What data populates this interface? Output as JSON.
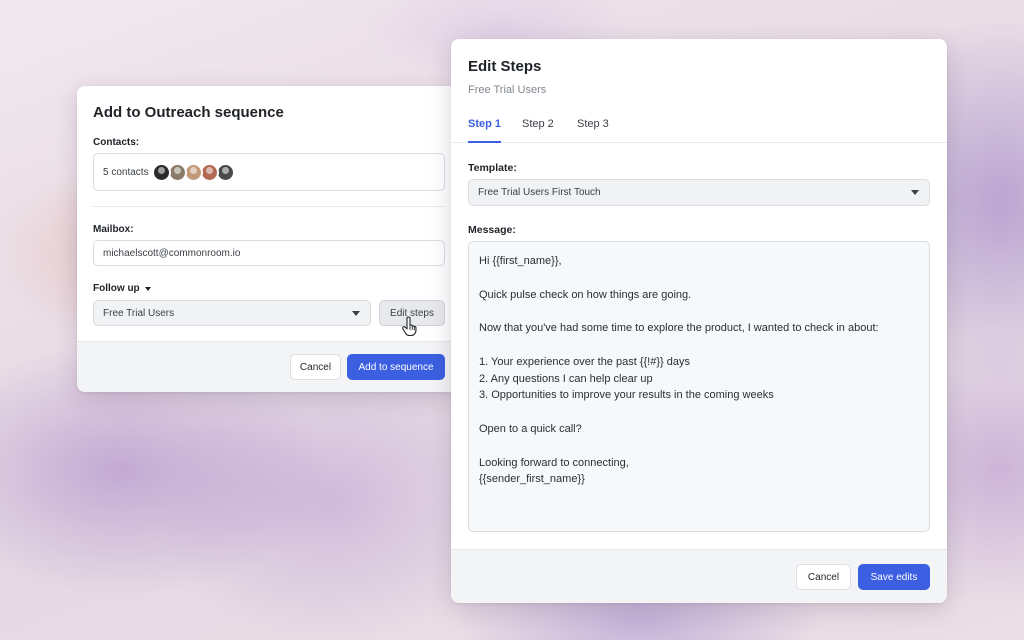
{
  "outreach": {
    "title": "Add to Outreach sequence",
    "contacts_label": "Contacts:",
    "contacts_count": "5 contacts",
    "avatar_colors": [
      "#2b2b2b",
      "#8a7a68",
      "#c29a7a",
      "#b46a52",
      "#4a4a4a"
    ],
    "mailbox_label": "Mailbox:",
    "mailbox_value": "michaelscott@commonroom.io",
    "followup_label": "Follow up",
    "sequence_value": "Free Trial Users",
    "edit_steps_label": "Edit steps",
    "cancel_label": "Cancel",
    "submit_label": "Add to sequence"
  },
  "edit_steps": {
    "title": "Edit Steps",
    "subtitle": "Free Trial Users",
    "tabs": [
      {
        "label": "Step 1",
        "active": true
      },
      {
        "label": "Step 2",
        "active": false
      },
      {
        "label": "Step 3",
        "active": false
      }
    ],
    "template_label": "Template:",
    "template_value": "Free Trial Users First Touch",
    "message_label": "Message:",
    "message_lines": [
      "Hi {{first_name}},",
      "",
      "Quick pulse check on how things are going.",
      "",
      "Now that you've had some time to explore the product, I wanted to check in about:",
      "",
      "1. Your experience over the past {{!#}} days",
      "2. Any questions I can help clear up",
      "3. Opportunities to improve your results in the coming weeks",
      "",
      "Open to a quick call?",
      "",
      "Looking forward to connecting,",
      "{{sender_first_name}}"
    ],
    "cancel_label": "Cancel",
    "save_label": "Save edits"
  },
  "colors": {
    "accent": "#3b5fe0",
    "muted_text": "#80868e"
  }
}
